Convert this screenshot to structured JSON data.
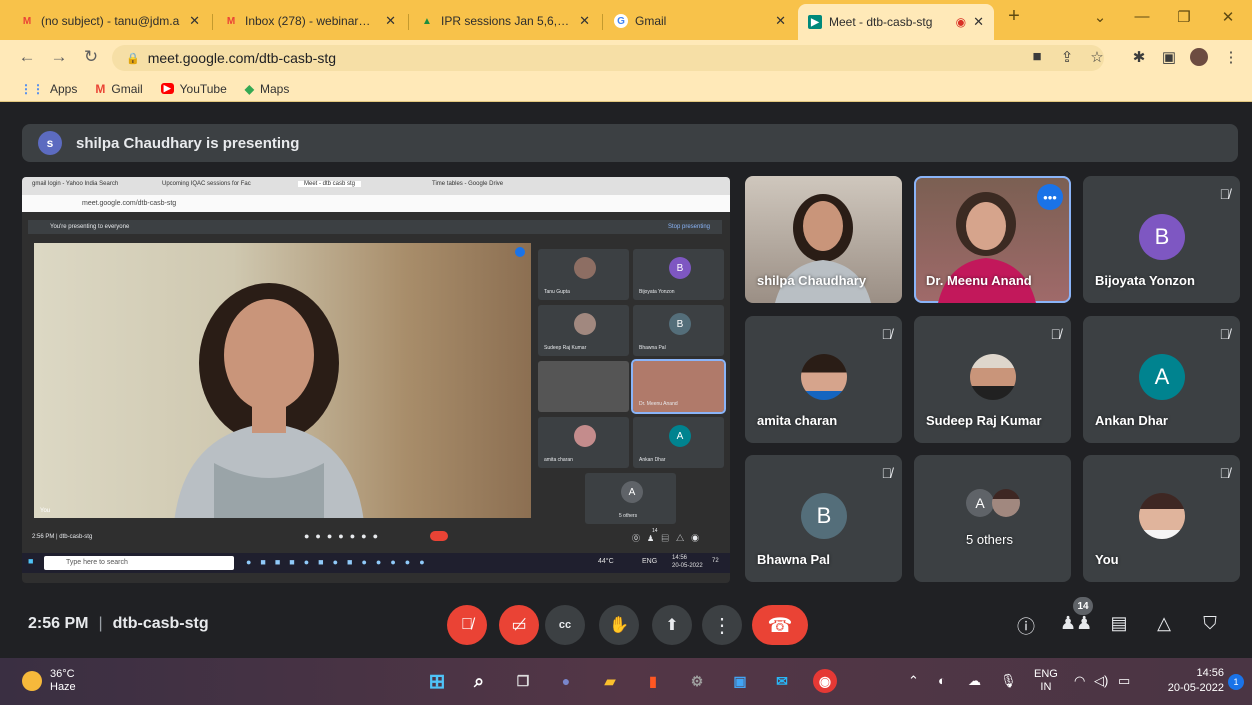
{
  "tabs": [
    {
      "label": "(no subject) - tanu@jdm.a",
      "icon": "gmail-icon",
      "color": "#ea4335"
    },
    {
      "label": "Inbox (278) - webinar@jd",
      "icon": "gmail-icon",
      "color": "#ea4335"
    },
    {
      "label": "IPR sessions Jan 5,6,7 - G",
      "icon": "drive-icon",
      "color": "#1e8e3e"
    },
    {
      "label": "Gmail",
      "icon": "google-icon",
      "color": "#4285f4"
    },
    {
      "label": "Meet - dtb-casb-stg",
      "icon": "meet-icon",
      "color": "#00897b"
    }
  ],
  "new_tab": "+",
  "window_controls": {
    "minimize": "—",
    "restore": "❐",
    "close": "✕",
    "dropdown": "⌄"
  },
  "address": {
    "url": "meet.google.com/dtb-casb-stg"
  },
  "bookmarks": [
    {
      "label": "Apps",
      "icon": "apps-grid-icon"
    },
    {
      "label": "Gmail",
      "icon": "gmail-icon"
    },
    {
      "label": "YouTube",
      "icon": "youtube-icon"
    },
    {
      "label": "Maps",
      "icon": "maps-icon"
    }
  ],
  "presenting": {
    "avatar": "s",
    "text": "shilpa Chaudhary is presenting"
  },
  "shared_screen": {
    "tabs": [
      "gmail login - Yahoo India Search",
      "Upcoming IQAC sessions for Fac",
      "Meet - dtb casb stg",
      "Time tables - Google Drive"
    ],
    "url": "meet.google.com/dtb-casb-stg",
    "banner": "You're presenting to everyone",
    "stop": "Stop presenting",
    "tiles": [
      {
        "name": "Tanu Gupta",
        "initial": ""
      },
      {
        "name": "Bijoyata Yonzon",
        "initial": "B"
      },
      {
        "name": "Sudeep Raj Kumar",
        "initial": ""
      },
      {
        "name": "Bhawna Pal",
        "initial": "B"
      },
      {
        "name": "",
        "initial": ""
      },
      {
        "name": "Dr. Meenu Anand",
        "initial": ""
      },
      {
        "name": "amita charan",
        "initial": ""
      },
      {
        "name": "Ankan Dhar",
        "initial": "A"
      },
      {
        "name": "5 others",
        "initial": "A"
      }
    ],
    "you": "You",
    "time": "2:56 PM",
    "code": "dtb-casb-stg",
    "badge": "14",
    "search": "Type here to search",
    "temp": "44°C",
    "lang": "ENG",
    "clock_time": "14:56",
    "clock_date": "20-05-2022",
    "notif": "72"
  },
  "participants": [
    {
      "name": "shilpa Chaudhary",
      "type": "photo",
      "muted": false
    },
    {
      "name": "Dr. Meenu Anand",
      "type": "photo",
      "muted": false,
      "more": "•••"
    },
    {
      "name": "Bijoyata Yonzon",
      "type": "avatar",
      "initial": "B",
      "color": "#7e57c2",
      "muted": true
    },
    {
      "name": "amita charan",
      "type": "face",
      "muted": true
    },
    {
      "name": "Sudeep Raj Kumar",
      "type": "face",
      "muted": true
    },
    {
      "name": "Ankan Dhar",
      "type": "avatar",
      "initial": "A",
      "color": "#00838f",
      "muted": true
    },
    {
      "name": "Bhawna Pal",
      "type": "avatar",
      "initial": "B",
      "color": "#546e7a",
      "muted": true
    },
    {
      "name": "5 others",
      "type": "others",
      "initial": "A",
      "muted": false
    },
    {
      "name": "You",
      "type": "face",
      "muted": true
    }
  ],
  "bottom": {
    "time": "2:56 PM",
    "separator": "|",
    "code": "dtb-casb-stg",
    "people_count": "14"
  },
  "taskbar": {
    "temp": "36°C",
    "weather": "Haze",
    "lang_top": "ENG",
    "lang_bottom": "IN",
    "time": "14:56",
    "date": "20-05-2022",
    "notifications": "1"
  }
}
